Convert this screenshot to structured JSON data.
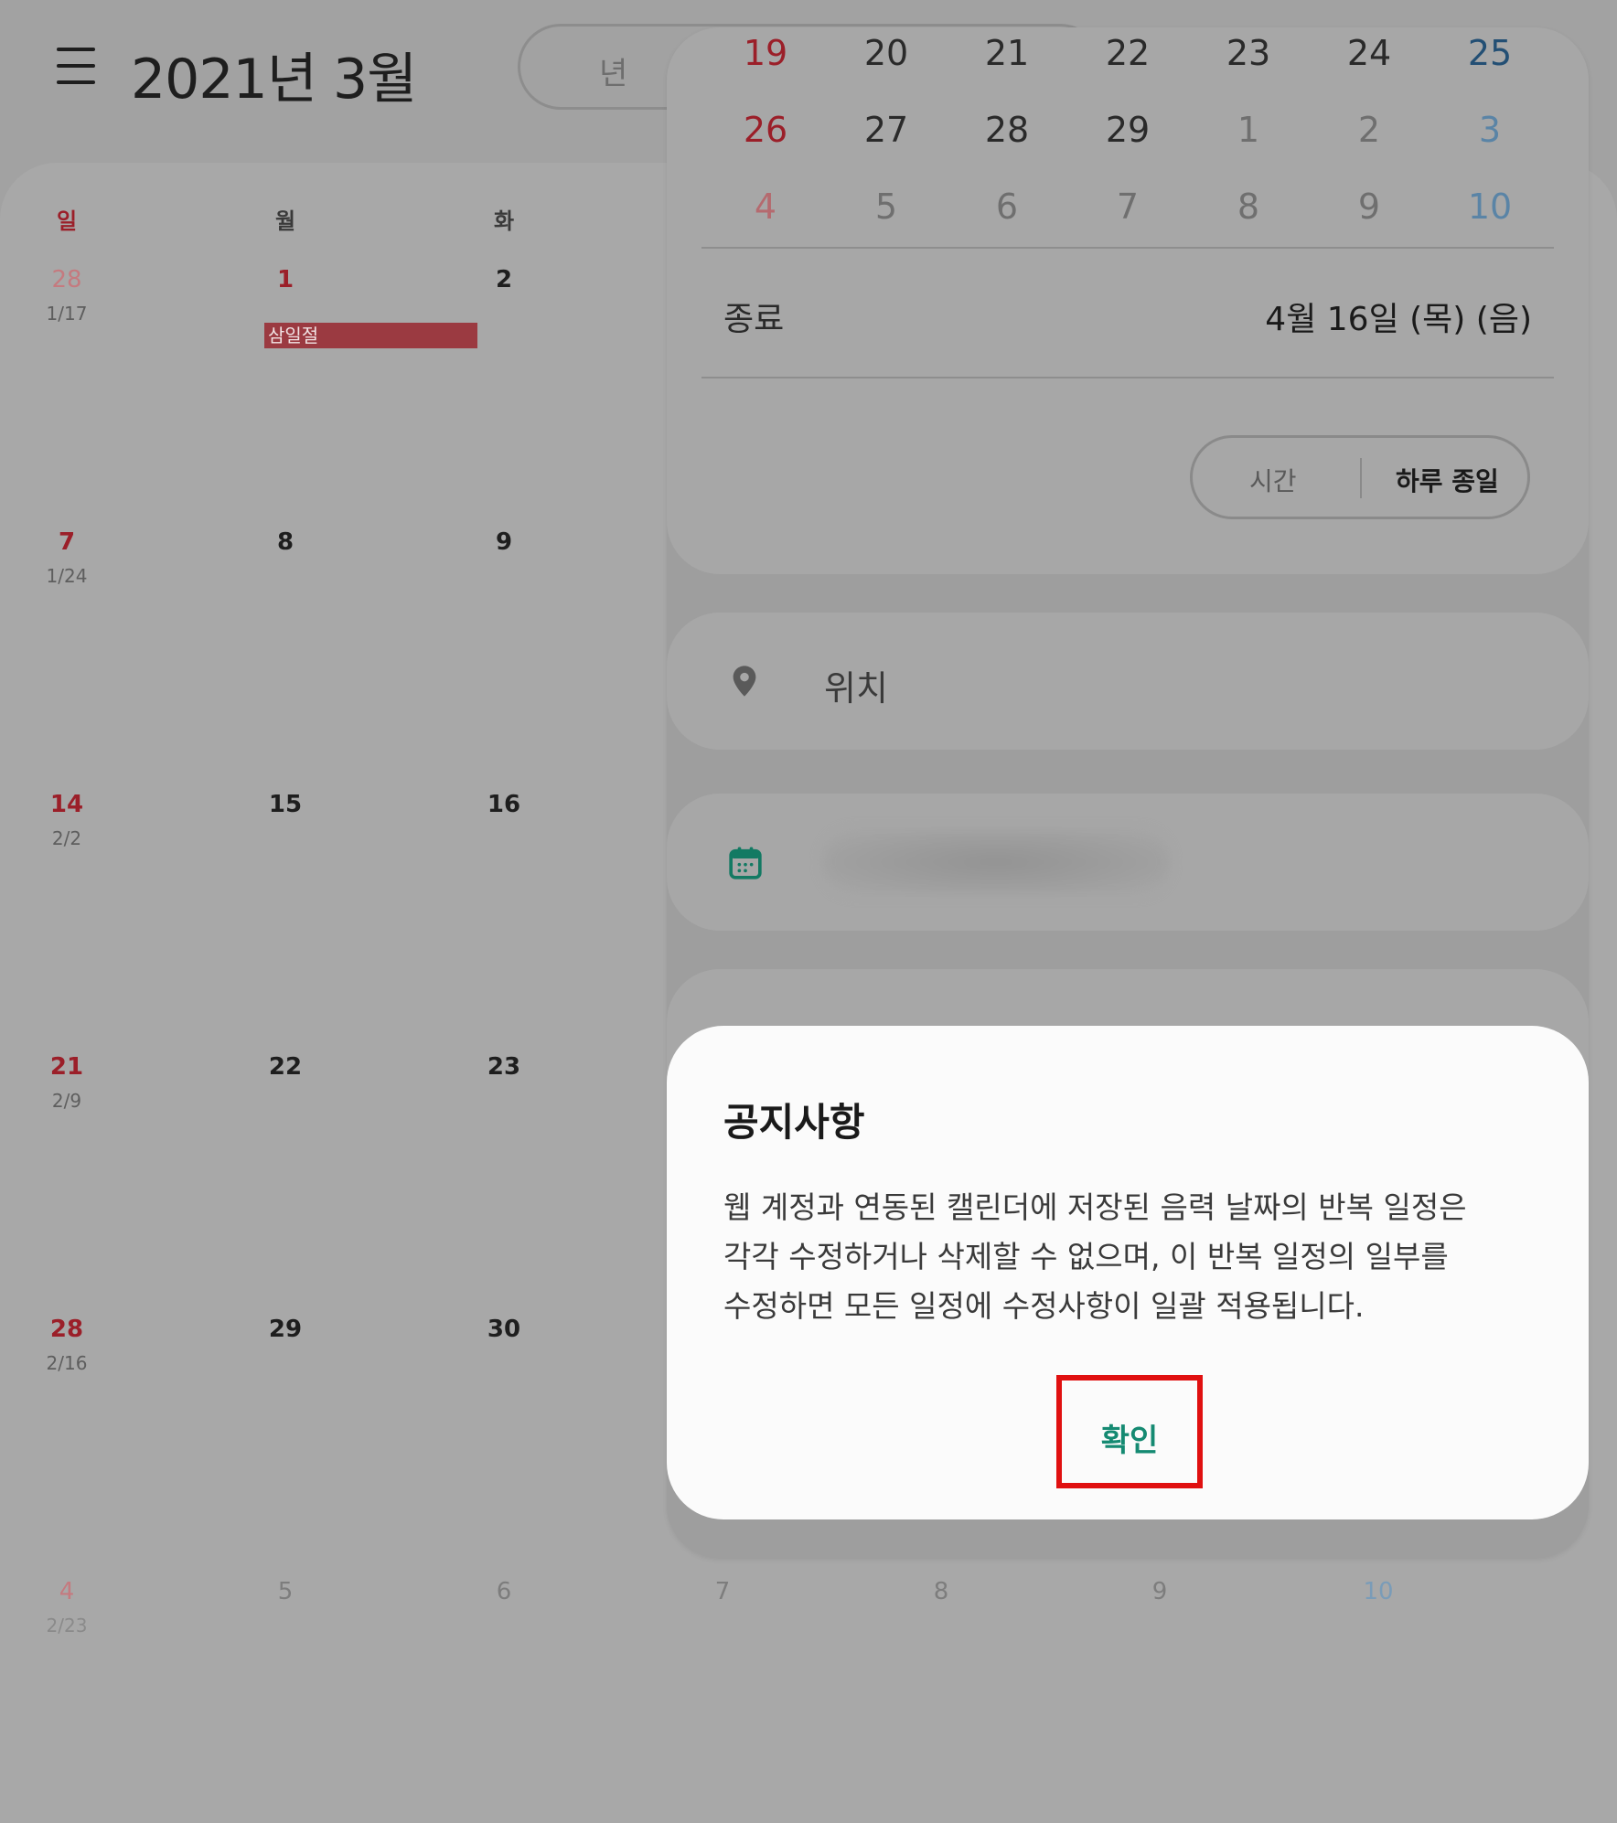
{
  "header": {
    "month_title": "2021년 3월",
    "view_toggle_label": "년"
  },
  "month_grid": {
    "weekdays": [
      "일",
      "월",
      "화"
    ],
    "weeks": [
      {
        "days": [
          "28",
          "1",
          "2"
        ],
        "lunar": "1/17"
      },
      {
        "days": [
          "7",
          "8",
          "9"
        ],
        "lunar": "1/24"
      },
      {
        "days": [
          "14",
          "15",
          "16"
        ],
        "lunar": "2/2"
      },
      {
        "days": [
          "21",
          "22",
          "23"
        ],
        "lunar": "2/9"
      },
      {
        "days": [
          "28",
          "29",
          "30"
        ],
        "lunar": "2/16"
      },
      {
        "days": [
          "4",
          "5",
          "6",
          "7",
          "8",
          "9",
          "10"
        ],
        "lunar": "2/23"
      }
    ],
    "holiday": "삼일절"
  },
  "event_sheet": {
    "mini_calendar": [
      [
        "19",
        "20",
        "21",
        "22",
        "23",
        "24",
        "25"
      ],
      [
        "26",
        "27",
        "28",
        "29",
        "1",
        "2",
        "3"
      ],
      [
        "4",
        "5",
        "6",
        "7",
        "8",
        "9",
        "10"
      ]
    ],
    "end_label": "종료",
    "end_value": "4월 16일 (목) (음)",
    "time_option": "시간",
    "allday_option": "하루 종일",
    "location_placeholder": "위치"
  },
  "dialog": {
    "title": "공지사항",
    "body_lines": [
      "웹 계정과 연동된 캘린더에 저장된 음력 날짜의 반복 일정은",
      "각각 수정하거나 삭제할 수 없으며, 이 반복 일정의 일부를",
      "수정하면 모든 일정에 수정사항이 일괄 적용됩니다."
    ],
    "confirm_label": "확인"
  },
  "colors": {
    "sunday": "#9b1f29",
    "saturday": "#234f74",
    "confirm_text": "#158a72",
    "highlight_box": "#e01010",
    "holiday_bar": "#9b3a41"
  },
  "icons": [
    "menu-icon",
    "location-pin-icon",
    "calendar-icon"
  ]
}
